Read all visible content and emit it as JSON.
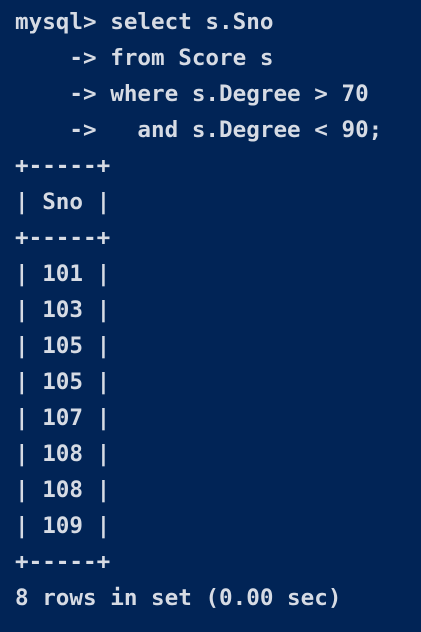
{
  "console": {
    "background": "#012456",
    "text_color": "#d6dbe4",
    "lines": [
      "mysql> select s.Sno",
      "    -> from Score s",
      "    -> where s.Degree > 70",
      "    ->   and s.Degree < 90;",
      "+-----+",
      "| Sno |",
      "+-----+",
      "| 101 |",
      "| 103 |",
      "| 105 |",
      "| 105 |",
      "| 107 |",
      "| 108 |",
      "| 108 |",
      "| 109 |",
      "+-----+",
      "8 rows in set (0.00 sec)"
    ]
  }
}
